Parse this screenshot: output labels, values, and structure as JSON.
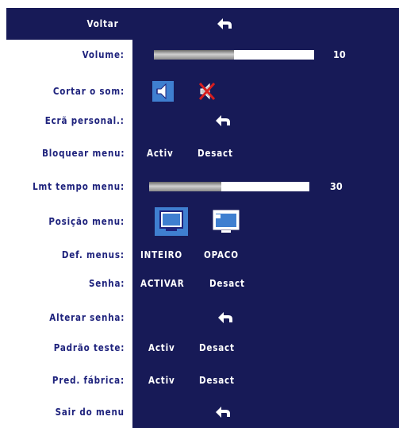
{
  "menu": {
    "back": {
      "label": "Voltar"
    },
    "volume": {
      "label": "Volume:",
      "value": "10",
      "level": 0.5
    },
    "mute": {
      "label": "Cortar o som:",
      "icons": [
        "speaker-on-icon",
        "speaker-muted-icon"
      ]
    },
    "custom_screen": {
      "label": "Ecrã personal.:"
    },
    "lock_menu": {
      "label": "Bloquear menu:",
      "on": "Activ",
      "off": "Desact"
    },
    "menu_timeout": {
      "label": "Lmt tempo menu:",
      "value": "30",
      "level": 0.45
    },
    "menu_position": {
      "label": "Posição menu:",
      "icons": [
        "position-center-icon",
        "position-top-left-icon"
      ]
    },
    "menu_def": {
      "label": "Def. menus:",
      "opt1": "INTEIRO",
      "opt2": "OPACO"
    },
    "password": {
      "label": "Senha:",
      "on": "ACTIVAR",
      "off": "Desact"
    },
    "change_password": {
      "label": "Alterar senha:"
    },
    "test_pattern": {
      "label": "Padrão teste:",
      "on": "Activ",
      "off": "Desact"
    },
    "factory_default": {
      "label": "Pred. fábrica:",
      "on": "Activ",
      "off": "Desact"
    },
    "exit_menu": {
      "label": "Sair do menu"
    }
  },
  "colors": {
    "panel": "#171a57",
    "label": "#1f237d",
    "selected_icon": "#3f7fd0"
  }
}
